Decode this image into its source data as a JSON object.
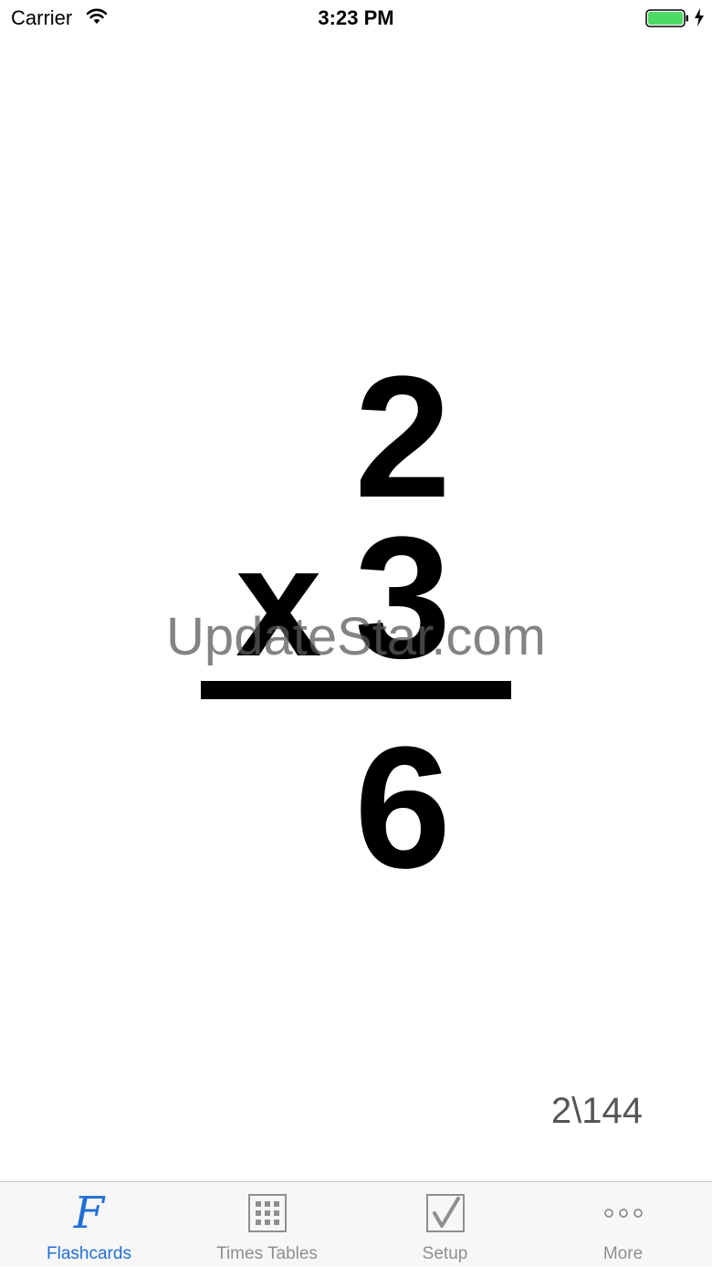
{
  "status_bar": {
    "carrier": "Carrier",
    "time": "3:23 PM",
    "icons": [
      "wifi-icon",
      "battery-icon",
      "charging-icon"
    ],
    "battery_color": "#4cd964"
  },
  "flashcard": {
    "top_number": "2",
    "operator": "x",
    "bottom_number": "3",
    "answer": "6",
    "progress": "2\\144"
  },
  "watermark": "UpdateStar.com",
  "tab_bar": {
    "active_color": "#1f6fd6",
    "inactive_color": "#8e8e93",
    "tabs": [
      {
        "label": "Flashcards",
        "icon": "flashcards-f-icon",
        "active": true,
        "glyph": "F"
      },
      {
        "label": "Times Tables",
        "icon": "grid-icon",
        "active": false
      },
      {
        "label": "Setup",
        "icon": "checkbox-icon",
        "active": false
      },
      {
        "label": "More",
        "icon": "more-dots-icon",
        "active": false
      }
    ]
  }
}
